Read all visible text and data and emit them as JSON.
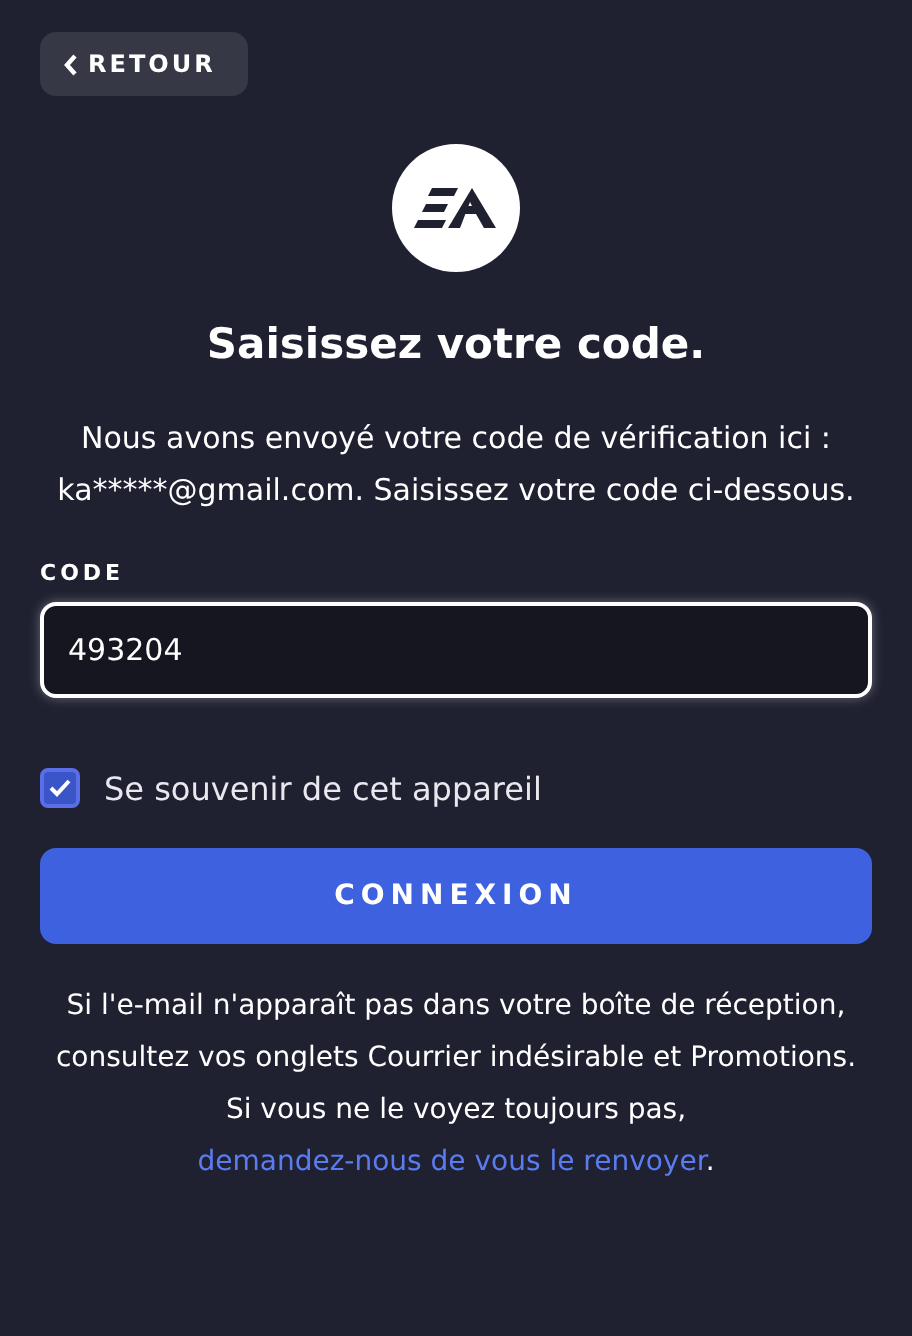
{
  "back_button": {
    "label": "RETOUR"
  },
  "title": "Saisissez votre code.",
  "description": "Nous avons envoyé votre code de vérification ici : ka*****@gmail.com. Saisissez votre code ci-dessous.",
  "code_field": {
    "label": "CODE",
    "value": "493204"
  },
  "remember_device": {
    "label": "Se souvenir de cet appareil",
    "checked": true
  },
  "submit_button": {
    "label": "CONNEXION"
  },
  "help": {
    "text": "Si l'e-mail n'apparaît pas dans votre boîte de réception, consultez vos onglets Courrier indésirable et Promotions. Si vous ne le voyez toujours pas, ",
    "link": "demandez-nous de vous le renvoyer",
    "end": "."
  }
}
